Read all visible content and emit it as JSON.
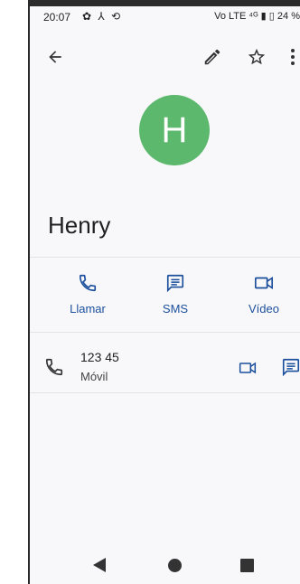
{
  "status_bar": {
    "time": "20:07",
    "icons": "✿ ⅄ ⟲",
    "network": "Vo LTE ⁴ᴳ",
    "battery": "24 %"
  },
  "contact": {
    "initial": "H",
    "name": "Henry",
    "avatar_color": "#5cb86c"
  },
  "actions": {
    "call_label": "Llamar",
    "sms_label": "SMS",
    "video_label": "Vídeo"
  },
  "phone": {
    "number": "123 45",
    "type": "Móvil"
  },
  "accent_color": "#1b4f9c"
}
